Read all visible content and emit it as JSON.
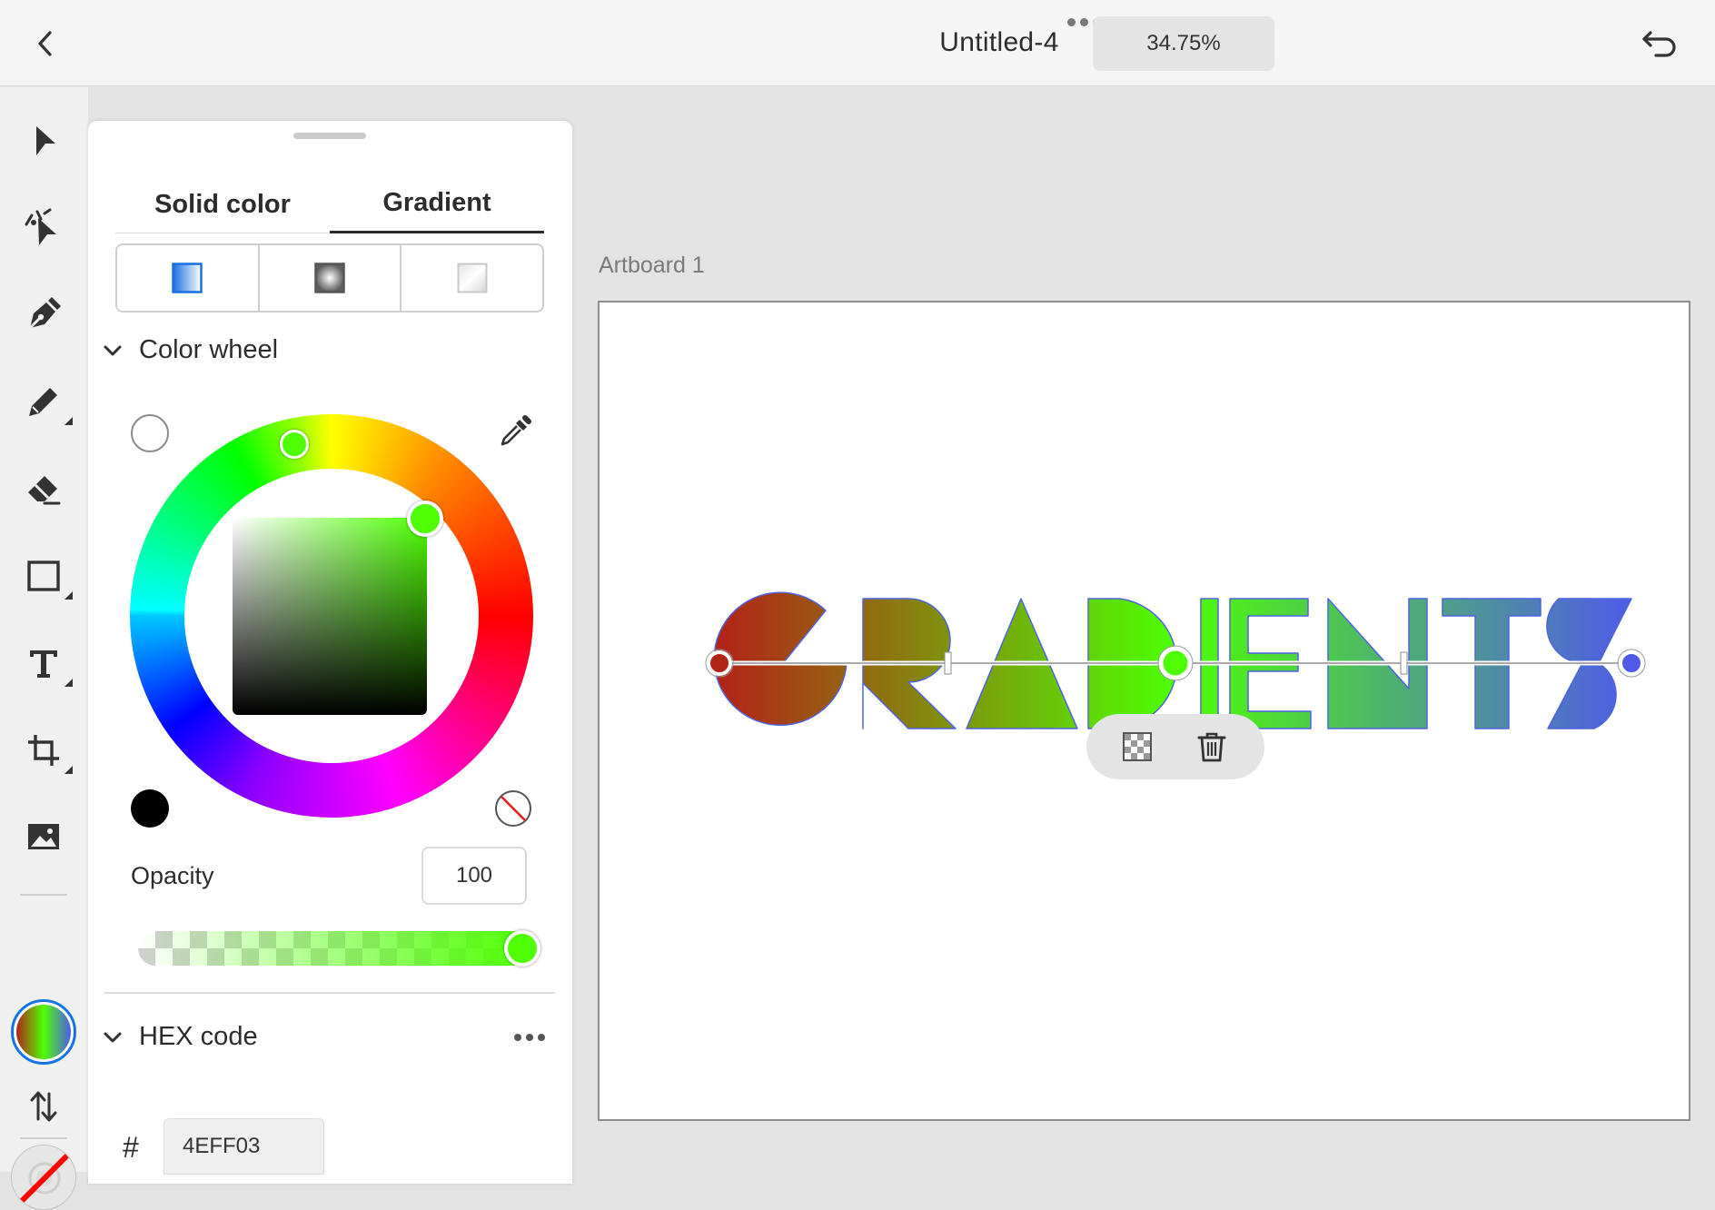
{
  "header": {
    "back_icon": "chevron-left-icon",
    "title": "Untitled-4",
    "more_icon": "ellipsis-icon",
    "zoom": "34.75%",
    "undo_icon": "undo-icon"
  },
  "toolbar": {
    "tools": [
      {
        "name": "selection-tool",
        "icon": "arrow-pointer-icon"
      },
      {
        "name": "direct-selection-tool",
        "icon": "direct-select-icon"
      },
      {
        "name": "pen-tool",
        "icon": "pen-nib-icon"
      },
      {
        "name": "pencil-tool",
        "icon": "pencil-icon"
      },
      {
        "name": "eraser-tool",
        "icon": "eraser-icon"
      },
      {
        "name": "rectangle-tool",
        "icon": "rectangle-icon"
      },
      {
        "name": "type-tool",
        "icon": "type-icon"
      },
      {
        "name": "artboard-tool",
        "icon": "artboard-icon"
      },
      {
        "name": "place-image-tool",
        "icon": "image-icon"
      }
    ],
    "fill_gradient": [
      "#b22418",
      "#4eff03",
      "#4f5be8"
    ],
    "swap_icon": "swap-arrows-icon",
    "stroke": "none"
  },
  "panel": {
    "tabs": [
      {
        "label": "Solid color",
        "active": false
      },
      {
        "label": "Gradient",
        "active": true
      }
    ],
    "gradient_types": [
      {
        "name": "linear",
        "icon": "linear-gradient-icon",
        "selected": true
      },
      {
        "name": "radial",
        "icon": "radial-gradient-icon",
        "selected": false
      },
      {
        "name": "freeform",
        "icon": "freeform-gradient-icon",
        "selected": false
      }
    ],
    "color_wheel_section": "Color wheel",
    "color_wheel": {
      "selected_color": "#4eff03",
      "white_swatch": "#ffffff",
      "black_swatch": "#000000",
      "eyedropper_icon": "eyedropper-icon",
      "no_color_icon": "no-color-icon"
    },
    "opacity_label": "Opacity",
    "opacity_value": "100",
    "hex_section": "HEX code",
    "hex_hash": "#",
    "hex_value": "4EFF03"
  },
  "canvas": {
    "artboard_label": "Artboard 1",
    "artwork_text": "GRADIENTS",
    "gradient_stops": [
      "#b22418",
      "#4eff03",
      "#4f5be8"
    ],
    "stop_popup": {
      "transparency_icon": "checkerboard-icon",
      "delete_icon": "trash-icon"
    }
  }
}
